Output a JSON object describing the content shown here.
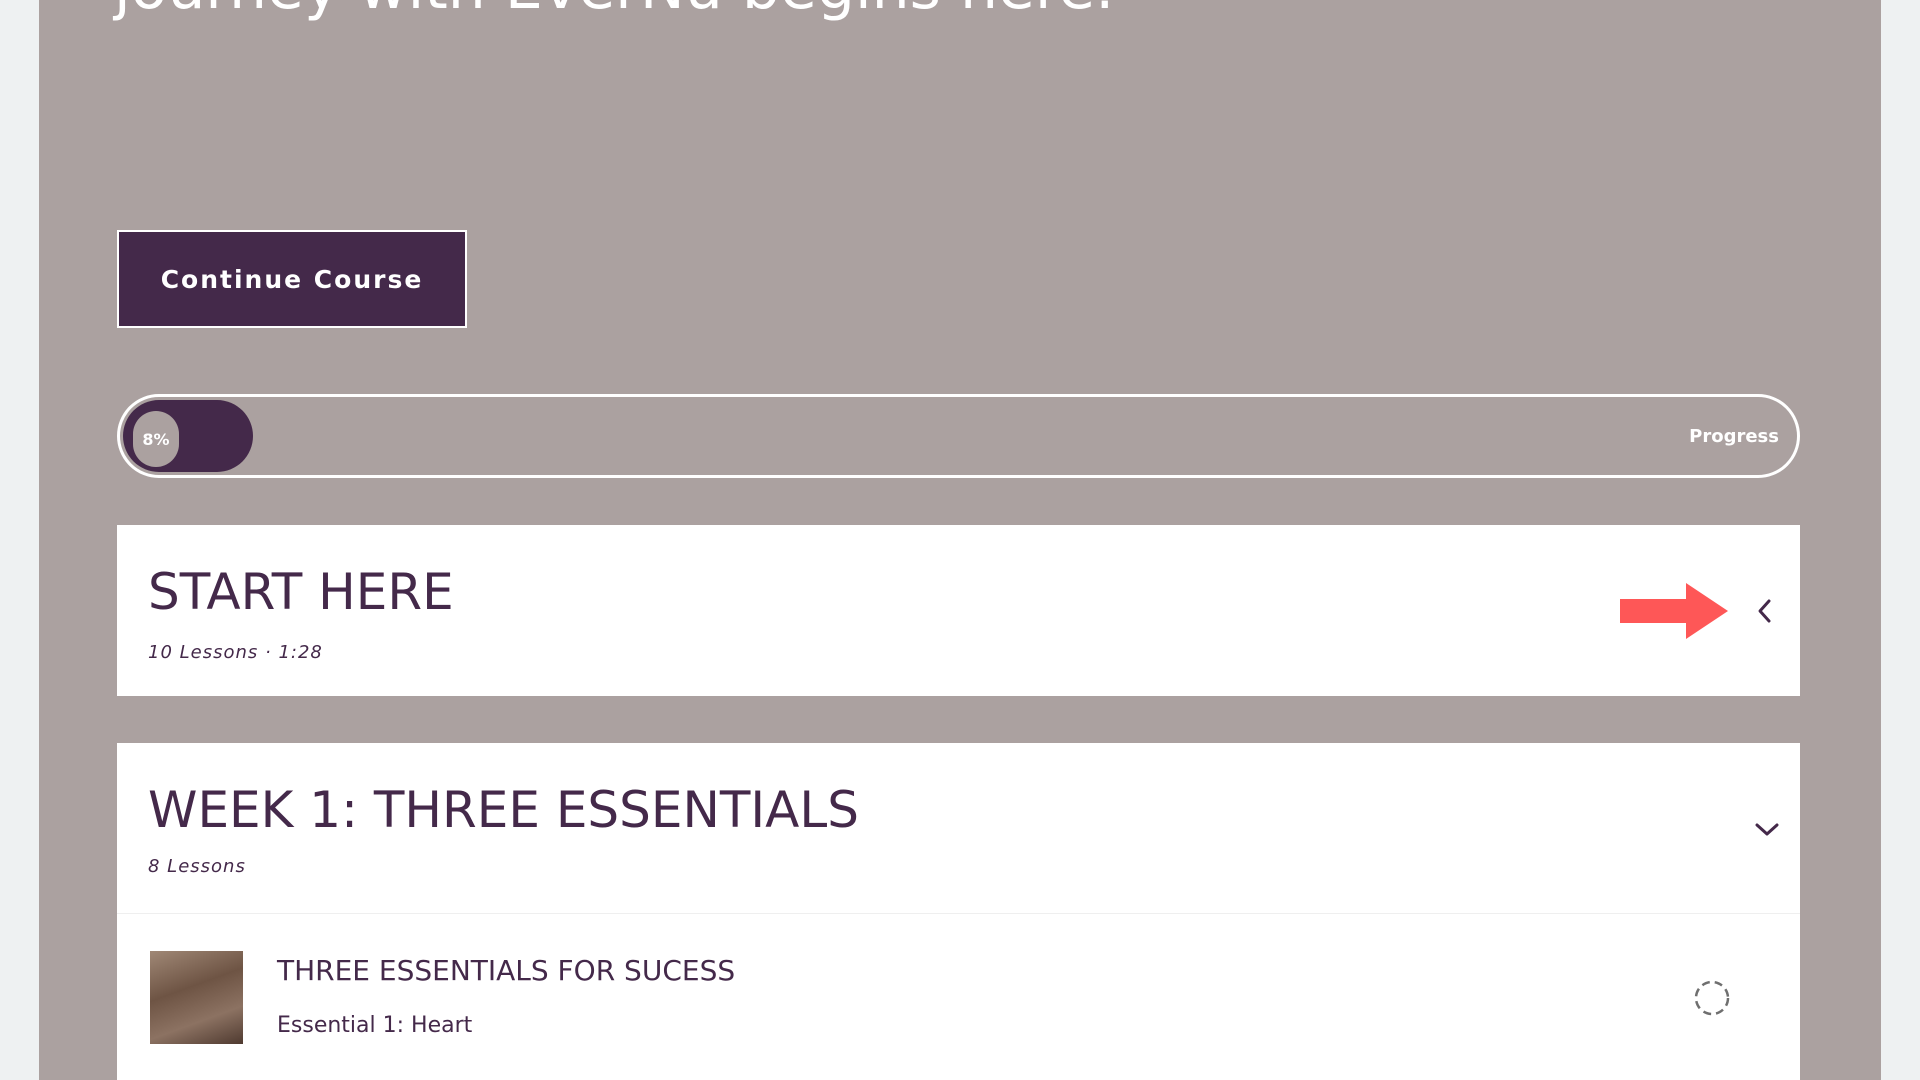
{
  "hero": {
    "title": "journey with EverNu begins here."
  },
  "continue_button": {
    "label": "Continue Course"
  },
  "progress": {
    "percent_text": "8%",
    "value": 0.08,
    "label": "Progress"
  },
  "sections": [
    {
      "title": "START HERE",
      "meta": "10 Lessons · 1:28",
      "chevron": "chevron-left-icon"
    },
    {
      "title": "WEEK 1: THREE ESSENTIALS",
      "meta": "8 Lessons",
      "chevron": "chevron-down-icon",
      "lessons": [
        {
          "title": "THREE ESSENTIALS FOR SUCESS",
          "subtitle": "Essential 1: Heart",
          "status_icon": "incomplete-circle-icon"
        }
      ]
    }
  ],
  "annotation": {
    "icon": "red-arrow-right-icon",
    "color": "#fe5757"
  },
  "colors": {
    "background": "#aba1a0",
    "accent": "#44294a",
    "card": "#ffffff"
  }
}
